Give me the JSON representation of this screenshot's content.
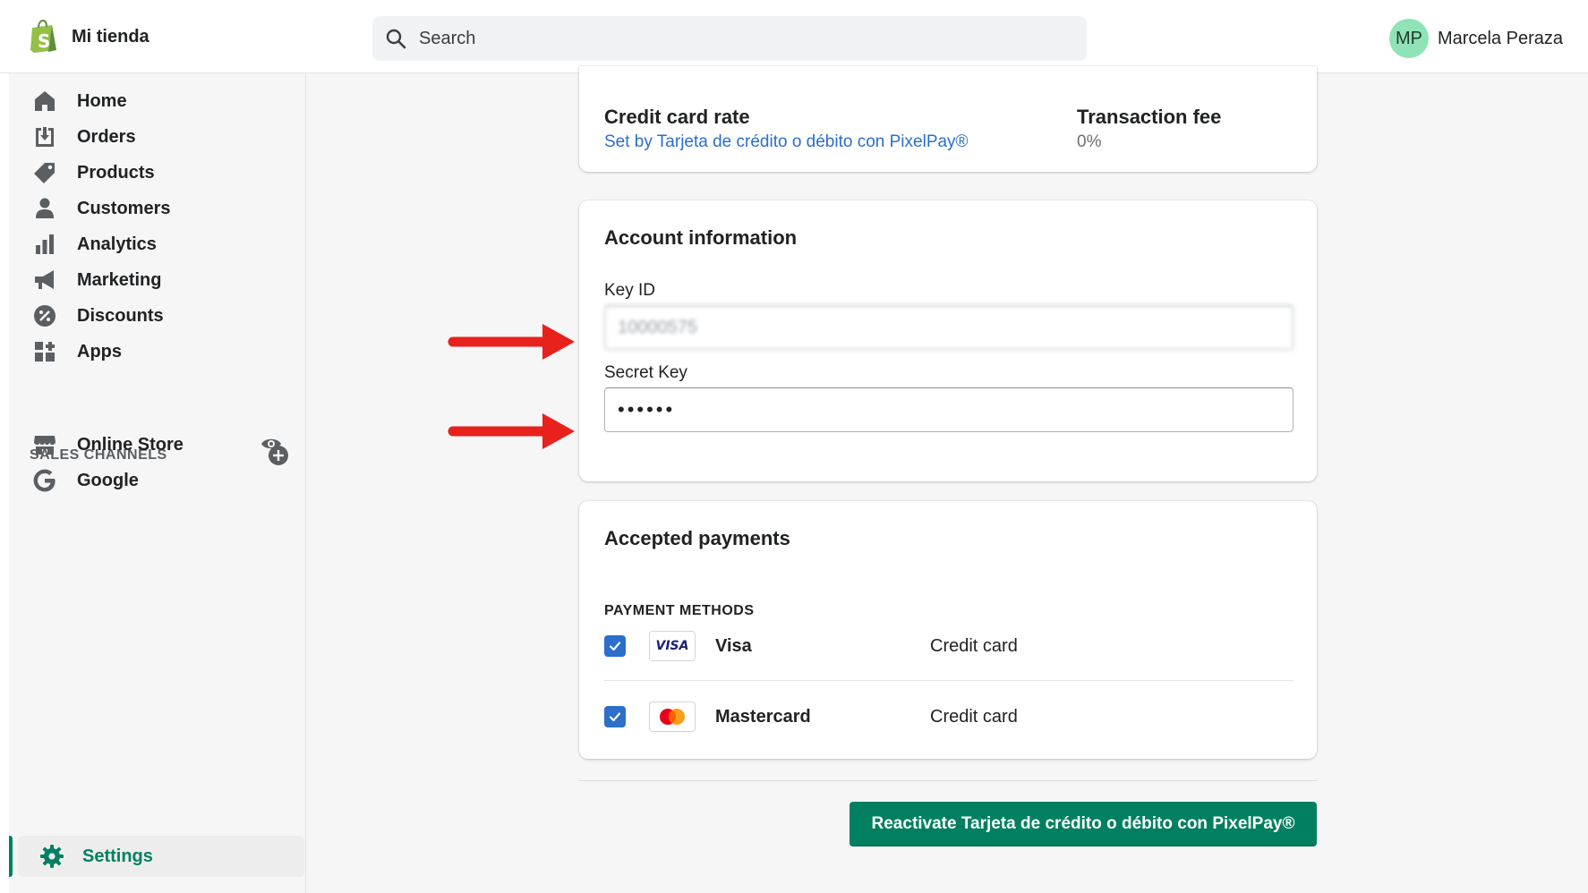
{
  "app": {
    "store_name": "Mi tienda",
    "search_placeholder": "Search",
    "user_initials": "MP",
    "user_name": "Marcela Peraza"
  },
  "sidebar": {
    "items": [
      {
        "label": "Home",
        "icon": "home-icon"
      },
      {
        "label": "Orders",
        "icon": "orders-icon"
      },
      {
        "label": "Products",
        "icon": "tag-icon"
      },
      {
        "label": "Customers",
        "icon": "person-icon"
      },
      {
        "label": "Analytics",
        "icon": "bar-chart-icon"
      },
      {
        "label": "Marketing",
        "icon": "megaphone-icon"
      },
      {
        "label": "Discounts",
        "icon": "discount-icon"
      },
      {
        "label": "Apps",
        "icon": "apps-icon"
      }
    ],
    "sales_channels_title": "SALES CHANNELS",
    "channels": [
      {
        "label": "Online Store",
        "icon": "store-icon"
      },
      {
        "label": "Google",
        "icon": "google-icon"
      }
    ],
    "settings_label": "Settings"
  },
  "rate_card": {
    "credit_card_rate_title": "Credit card rate",
    "credit_card_rate_link": "Set by Tarjeta de crédito o débito con PixelPay®",
    "transaction_fee_title": "Transaction fee",
    "transaction_fee_value": "0%"
  },
  "account": {
    "title": "Account information",
    "key_id_label": "Key ID",
    "key_id_value": "10000575",
    "secret_key_label": "Secret Key",
    "secret_key_value": "••••••"
  },
  "payments": {
    "title": "Accepted payments",
    "methods_title": "PAYMENT METHODS",
    "methods": [
      {
        "name": "Visa",
        "type": "Credit card",
        "checked": true,
        "logo_text": "VISA"
      },
      {
        "name": "Mastercard",
        "type": "Credit card",
        "checked": true
      }
    ]
  },
  "actions": {
    "reactivate_label": "Reactivate Tarjeta de crédito o débito con PixelPay®"
  },
  "colors": {
    "primary": "#008060",
    "link": "#2c6ecb",
    "annotation_arrow": "#e8211c"
  }
}
